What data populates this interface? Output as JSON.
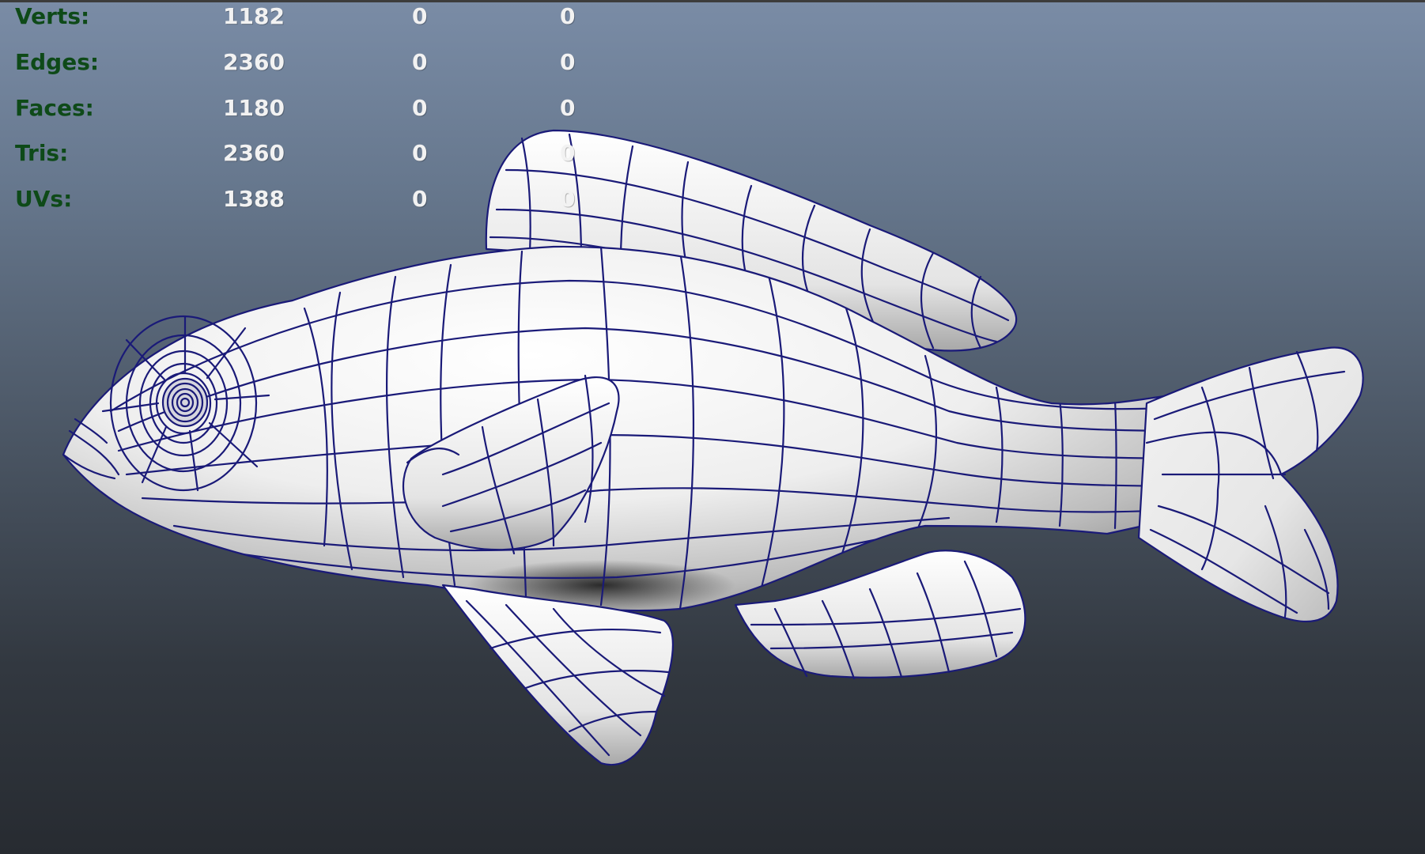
{
  "viewport": {
    "background_top": "#7a8ca6",
    "background_bottom": "#272b31",
    "wireframe_color": "#1a1a78"
  },
  "hud": {
    "rows": [
      {
        "label": "Verts:",
        "values": [
          "1182",
          "0",
          "0"
        ]
      },
      {
        "label": "Edges:",
        "values": [
          "2360",
          "0",
          "0"
        ]
      },
      {
        "label": "Faces:",
        "values": [
          "1180",
          "0",
          "0"
        ]
      },
      {
        "label": "Tris:",
        "values": [
          "2360",
          "0",
          "0"
        ]
      },
      {
        "label": "UVs:",
        "values": [
          "1388",
          "0",
          "0"
        ]
      }
    ]
  },
  "model": {
    "icon": "fish-wireframe-mesh"
  }
}
